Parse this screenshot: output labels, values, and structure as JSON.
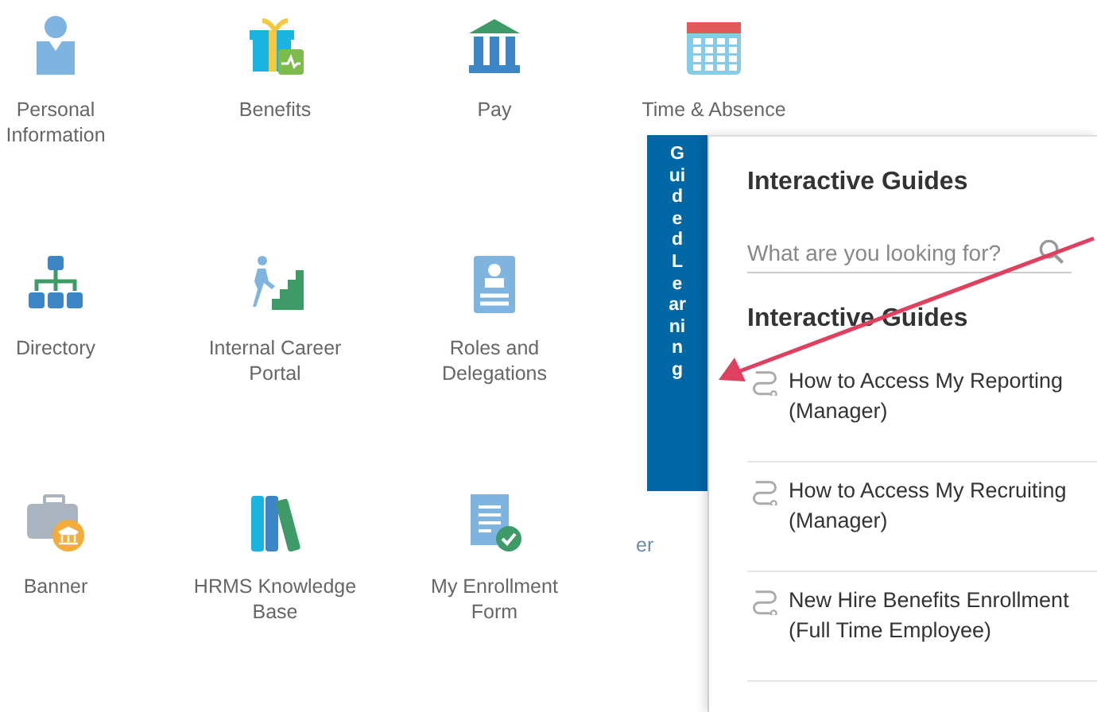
{
  "tiles": [
    {
      "label": "Personal Information",
      "kind": "person"
    },
    {
      "label": "Benefits",
      "kind": "gift"
    },
    {
      "label": "Pay",
      "kind": "bank"
    },
    {
      "label": "Time & Absence",
      "kind": "calendar"
    },
    {
      "label": "Directory",
      "kind": "org"
    },
    {
      "label": "Internal Career Portal",
      "kind": "stairs"
    },
    {
      "label": "Roles and Delegations",
      "kind": "badge"
    },
    {
      "label": "Banner",
      "kind": "briefcase"
    },
    {
      "label": "HRMS Knowledge Base",
      "kind": "books"
    },
    {
      "label": "My Enrollment Form",
      "kind": "form"
    }
  ],
  "hidden_label_fragment": "er",
  "guide_panel": {
    "tab_label": "Guided  Learning",
    "title": "Interactive Guides",
    "search": {
      "placeholder": "What are you looking for?"
    },
    "section_title": "Interactive Guides",
    "guides": [
      {
        "title": "How to Access My Reporting (Manager)"
      },
      {
        "title": "How to Access My Recruiting (Manager)"
      },
      {
        "title": "New Hire Benefits Enrollment (Full Time Employee)"
      }
    ]
  }
}
